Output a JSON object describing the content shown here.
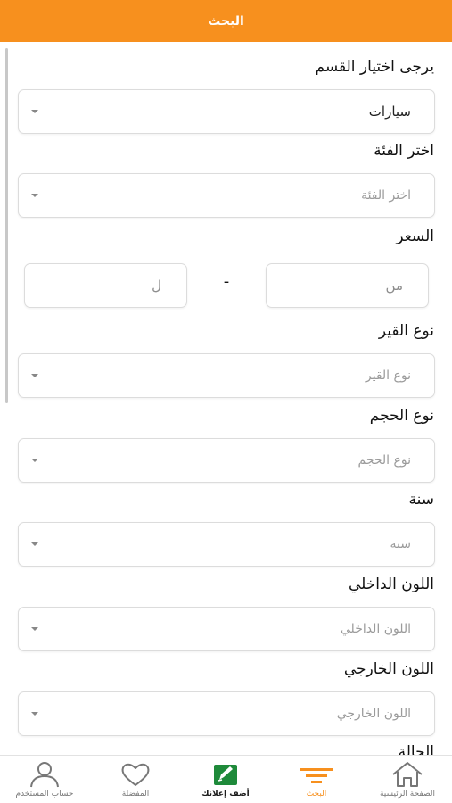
{
  "header": {
    "title": "البحث"
  },
  "form": {
    "section": {
      "label": "يرجى اختيار القسم",
      "value": "سيارات"
    },
    "category": {
      "label": "اختر الفئة",
      "placeholder": "اختر الفئة"
    },
    "price": {
      "label": "السعر",
      "from_placeholder": "من",
      "to_placeholder": "ل",
      "separator": "-"
    },
    "gear": {
      "label": "نوع القير",
      "placeholder": "نوع القير"
    },
    "size": {
      "label": "نوع الحجم",
      "placeholder": "نوع الحجم"
    },
    "year": {
      "label": "سنة",
      "placeholder": "سنة"
    },
    "interior_color": {
      "label": "اللون الداخلي",
      "placeholder": "اللون الداخلي"
    },
    "exterior_color": {
      "label": "اللون الخارجي",
      "placeholder": "اللون الخارجي"
    },
    "condition": {
      "label": "الحالة"
    }
  },
  "tabbar": {
    "home": {
      "label": "الصفحة الرئيسية",
      "icon": "home-icon"
    },
    "search": {
      "label": "البحث",
      "icon": "filter-icon"
    },
    "add_ad": {
      "label": "أضف إعلانك",
      "icon": "add-ad-icon"
    },
    "favorites": {
      "label": "المفضلة",
      "icon": "heart-icon"
    },
    "account": {
      "label": "حساب المستخدم",
      "icon": "user-icon"
    }
  },
  "colors": {
    "accent": "#f7901e",
    "add_ad_green": "#1e8a3a",
    "border": "#dcdcdc"
  }
}
